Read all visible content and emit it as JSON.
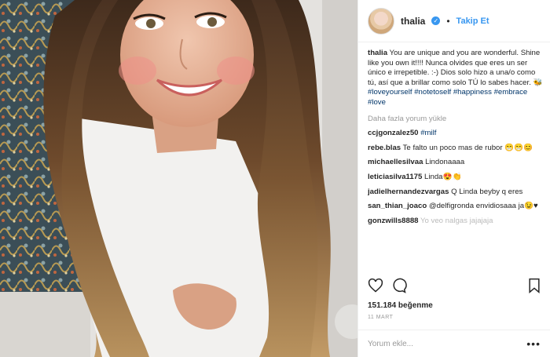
{
  "post": {
    "username": "thalia",
    "verified_mark": "✓",
    "separator": "•",
    "follow_label": "Takip Et",
    "caption_user": "thalia",
    "caption_text": "You are unique and you are wonderful. Shine like you own it!!!! Nunca olvides que eres un ser único e irrepetible. :-) Dios solo hizo a una/o como tú, así que a brillar como solo TÚ lo sabes hacer. 🐝",
    "hashtags": [
      "#loveyourself",
      "#notetoself",
      "#happiness",
      "#embrace",
      "#love"
    ],
    "load_more": "Daha fazla yorum yükle",
    "comments": [
      {
        "user": "ccjgonzalez50",
        "text": "#milf"
      },
      {
        "user": "rebe.blas",
        "text": "Te falto un poco mas de rubor 😁😁😊"
      },
      {
        "user": "michaellesilvaa",
        "text": "Lindonaaaa"
      },
      {
        "user": "leticiasilva1175",
        "text": "Linda😍👏"
      },
      {
        "user": "jadielhernandezvargas",
        "text": "Q Linda beyby q eres"
      },
      {
        "user": "san_thian_joaco",
        "text": "@delfigronda envidiosaaa ja😉♥"
      },
      {
        "user": "gonzwills8888",
        "text": "Yo veo nalgas jajajaja"
      }
    ],
    "likes": "151.184 beğenme",
    "date": "11 MART",
    "comment_placeholder": "Yorum ekle...",
    "more_dots": "•••"
  },
  "icons": {
    "heart": "heart-icon",
    "comment": "comment-icon",
    "bookmark": "bookmark-icon"
  },
  "colors": {
    "link": "#3897f0",
    "hashtag": "#003569",
    "muted": "#999999"
  }
}
